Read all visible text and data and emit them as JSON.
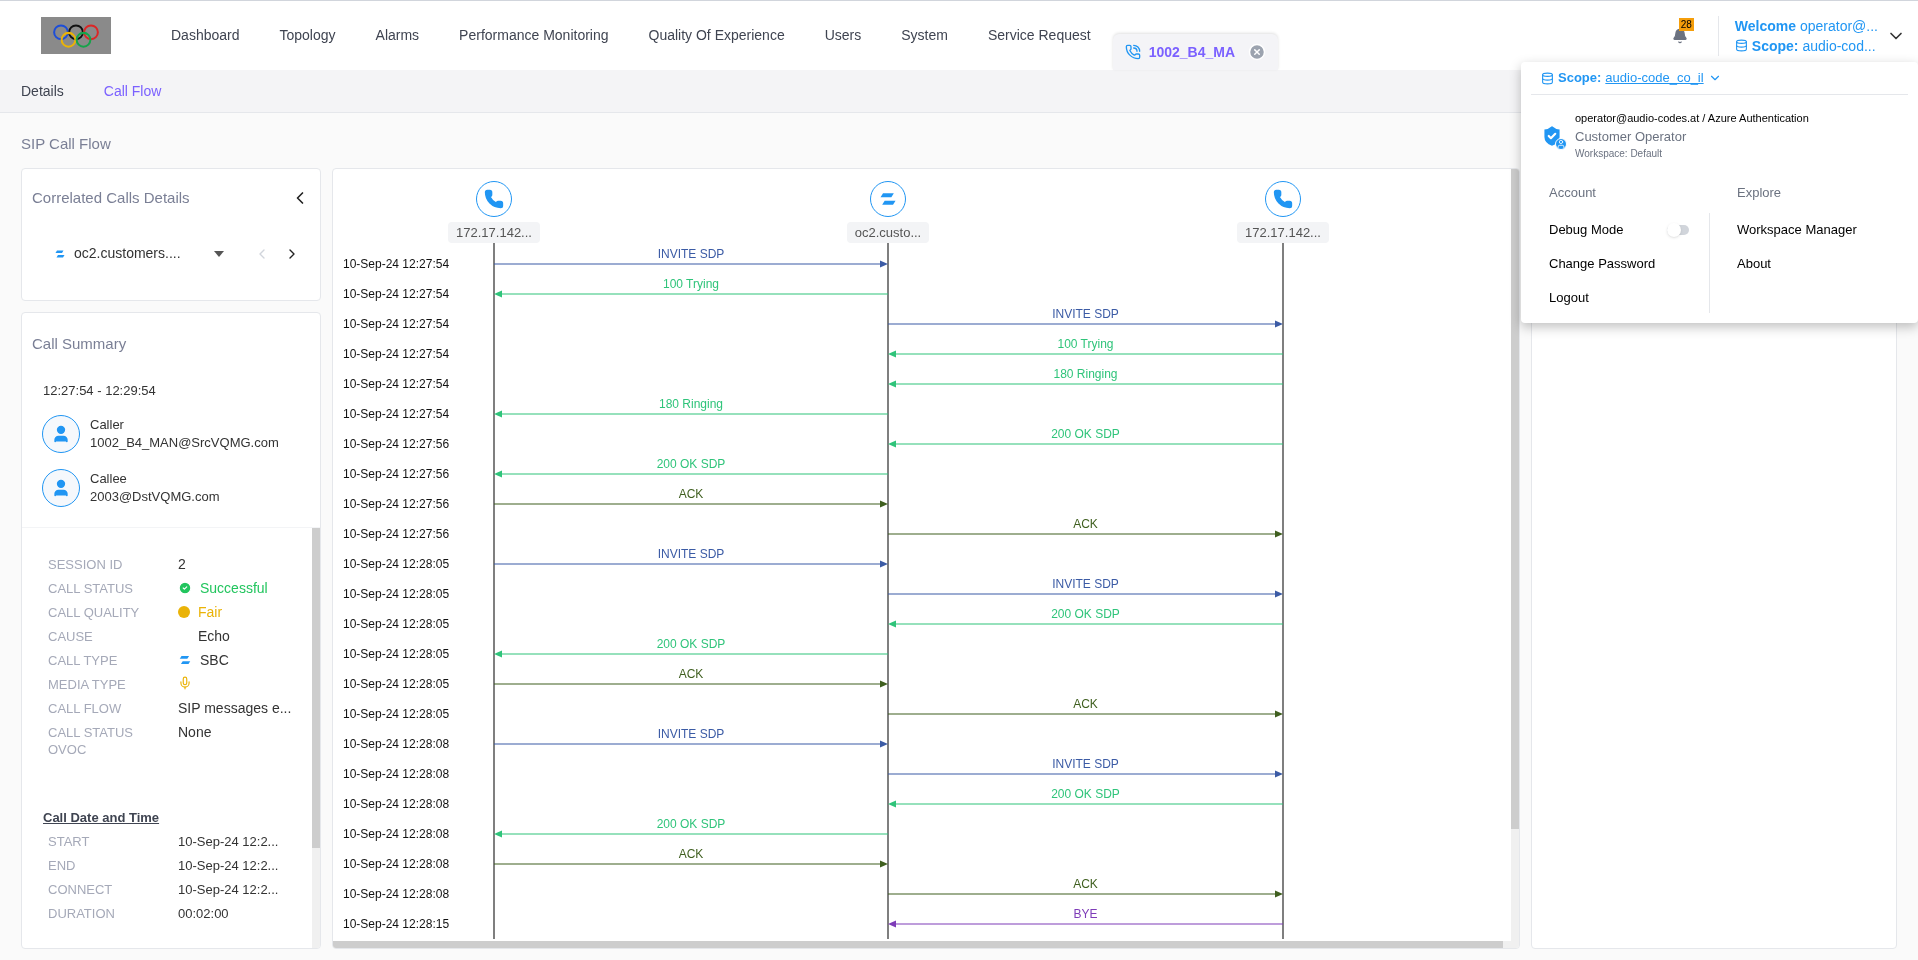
{
  "nav": {
    "items": [
      {
        "label": "Dashboard"
      },
      {
        "label": "Topology"
      },
      {
        "label": "Alarms"
      },
      {
        "label": "Performance Monitoring"
      },
      {
        "label": "Quality Of Experience"
      },
      {
        "label": "Users"
      },
      {
        "label": "System"
      },
      {
        "label": "Service Request"
      }
    ],
    "open_tab": {
      "label": "1002_B4_MA"
    },
    "notifications": "28",
    "welcome": {
      "label": "Welcome",
      "user": "operator@..."
    },
    "scope": {
      "label": "Scope:",
      "value": "audio-cod..."
    }
  },
  "subtabs": [
    {
      "label": "Details",
      "selected": false
    },
    {
      "label": "Call Flow",
      "selected": true
    }
  ],
  "page_title": "SIP Call Flow",
  "correlated": {
    "title": "Correlated Calls Details",
    "selected_call": "oc2.customers...."
  },
  "summary": {
    "title": "Call Summary",
    "time_range": "12:27:54 - 12:29:54",
    "parties": [
      {
        "role": "Caller",
        "address": "1002_B4_MAN@SrcVQMG.com"
      },
      {
        "role": "Callee",
        "address": "2003@DstVQMG.com"
      }
    ],
    "fields": [
      {
        "label": "SESSION ID",
        "value": "2",
        "kind": "text"
      },
      {
        "label": "CALL STATUS",
        "value": "Successful",
        "kind": "status",
        "color": "#22c55e"
      },
      {
        "label": "CALL QUALITY",
        "value": "Fair",
        "kind": "quality",
        "color": "#eab308"
      },
      {
        "label": "CAUSE",
        "value": "Echo",
        "kind": "indented"
      },
      {
        "label": "CALL TYPE",
        "value": "SBC",
        "kind": "sbc"
      },
      {
        "label": "MEDIA TYPE",
        "kind": "media"
      },
      {
        "label": "CALL FLOW",
        "value": "SIP messages e...",
        "kind": "text"
      },
      {
        "label": "CALL STATUS OVOC",
        "value": "None",
        "kind": "text"
      }
    ],
    "date_section": {
      "title": "Call Date and Time",
      "fields": [
        {
          "label": "START",
          "value": "10-Sep-24 12:2..."
        },
        {
          "label": "END",
          "value": "10-Sep-24 12:2..."
        },
        {
          "label": "CONNECT",
          "value": "10-Sep-24 12:2..."
        },
        {
          "label": "DURATION",
          "value": "00:02:00"
        }
      ]
    }
  },
  "flow": {
    "nodes": [
      {
        "name": "172.17.142...",
        "kind": "phone"
      },
      {
        "name": "oc2.custo...",
        "kind": "sbc"
      },
      {
        "name": "172.17.142...",
        "kind": "phone"
      }
    ],
    "messages": [
      {
        "time": "10-Sep-24 12:27:54",
        "right_span": false,
        "leftward": false,
        "label": "INVITE SDP",
        "kind": "request"
      },
      {
        "time": "10-Sep-24 12:27:54",
        "right_span": false,
        "leftward": true,
        "label": "100 Trying",
        "kind": "response"
      },
      {
        "time": "10-Sep-24 12:27:54",
        "right_span": true,
        "leftward": false,
        "label": "INVITE SDP",
        "kind": "request"
      },
      {
        "time": "10-Sep-24 12:27:54",
        "right_span": true,
        "leftward": true,
        "label": "100 Trying",
        "kind": "response"
      },
      {
        "time": "10-Sep-24 12:27:54",
        "right_span": true,
        "leftward": true,
        "label": "180 Ringing",
        "kind": "response"
      },
      {
        "time": "10-Sep-24 12:27:54",
        "right_span": false,
        "leftward": true,
        "label": "180 Ringing",
        "kind": "response"
      },
      {
        "time": "10-Sep-24 12:27:56",
        "right_span": true,
        "leftward": true,
        "label": "200 OK SDP",
        "kind": "response"
      },
      {
        "time": "10-Sep-24 12:27:56",
        "right_span": false,
        "leftward": true,
        "label": "200 OK SDP",
        "kind": "response"
      },
      {
        "time": "10-Sep-24 12:27:56",
        "right_span": false,
        "leftward": false,
        "label": "ACK",
        "kind": "ack"
      },
      {
        "time": "10-Sep-24 12:27:56",
        "right_span": true,
        "leftward": false,
        "label": "ACK",
        "kind": "ack"
      },
      {
        "time": "10-Sep-24 12:28:05",
        "right_span": false,
        "leftward": false,
        "label": "INVITE SDP",
        "kind": "request"
      },
      {
        "time": "10-Sep-24 12:28:05",
        "right_span": true,
        "leftward": false,
        "label": "INVITE SDP",
        "kind": "request"
      },
      {
        "time": "10-Sep-24 12:28:05",
        "right_span": true,
        "leftward": true,
        "label": "200 OK SDP",
        "kind": "response"
      },
      {
        "time": "10-Sep-24 12:28:05",
        "right_span": false,
        "leftward": true,
        "label": "200 OK SDP",
        "kind": "response"
      },
      {
        "time": "10-Sep-24 12:28:05",
        "right_span": false,
        "leftward": false,
        "label": "ACK",
        "kind": "ack"
      },
      {
        "time": "10-Sep-24 12:28:05",
        "right_span": true,
        "leftward": false,
        "label": "ACK",
        "kind": "ack"
      },
      {
        "time": "10-Sep-24 12:28:08",
        "right_span": false,
        "leftward": false,
        "label": "INVITE SDP",
        "kind": "request"
      },
      {
        "time": "10-Sep-24 12:28:08",
        "right_span": true,
        "leftward": false,
        "label": "INVITE SDP",
        "kind": "request"
      },
      {
        "time": "10-Sep-24 12:28:08",
        "right_span": true,
        "leftward": true,
        "label": "200 OK SDP",
        "kind": "response"
      },
      {
        "time": "10-Sep-24 12:28:08",
        "right_span": false,
        "leftward": true,
        "label": "200 OK SDP",
        "kind": "response"
      },
      {
        "time": "10-Sep-24 12:28:08",
        "right_span": false,
        "leftward": false,
        "label": "ACK",
        "kind": "ack"
      },
      {
        "time": "10-Sep-24 12:28:08",
        "right_span": true,
        "leftward": false,
        "label": "ACK",
        "kind": "ack"
      },
      {
        "time": "10-Sep-24 12:28:15",
        "right_span": true,
        "leftward": true,
        "label": "BYE",
        "kind": "bye"
      }
    ]
  },
  "user_menu": {
    "scope": {
      "label": "Scope:",
      "value": "audio-code_co_il"
    },
    "account_line": "operator@audio-codes.at / Azure Authentication",
    "role": "Customer Operator",
    "workspace": "Workspace: Default",
    "account": {
      "title": "Account",
      "items": [
        {
          "label": "Debug Mode",
          "kind": "toggle",
          "on": false
        },
        {
          "label": "Change Password",
          "kind": "link"
        },
        {
          "label": "Logout",
          "kind": "link"
        }
      ]
    },
    "explore": {
      "title": "Explore",
      "items": [
        {
          "label": "Workspace Manager"
        },
        {
          "label": "About"
        }
      ]
    }
  }
}
